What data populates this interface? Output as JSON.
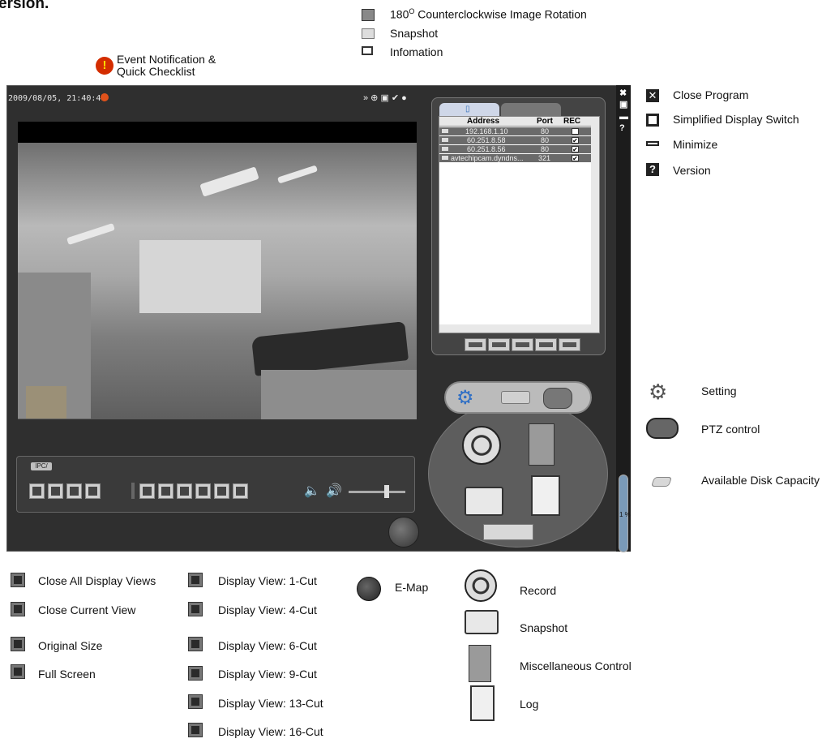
{
  "header": {
    "cut_title": "ersion."
  },
  "top_legend": [
    {
      "label": "180° Counterclockwise Image Rotation",
      "label_base": "180",
      "label_sup": "O",
      "label_rest": " Counterclockwise Image Rotation",
      "icon": "rotate-icon"
    },
    {
      "label": "Snapshot",
      "icon": "camera-small-icon"
    },
    {
      "label": "Infomation",
      "icon": "info-box-icon"
    }
  ],
  "event": {
    "line1": "Event Notification &",
    "line2": "Quick Checklist",
    "icon": "alert-icon"
  },
  "app": {
    "timestamp": "2009/08/05, 21:40:41",
    "osd_icons": "» ⊕ ▣ ✔ ●",
    "ipc_label": "IPC/",
    "address_list": {
      "headers": [
        "Address",
        "Port",
        "REC"
      ],
      "rows": [
        {
          "address": "192.168.1.10",
          "port": "80",
          "rec": ""
        },
        {
          "address": "60.251.8.58",
          "port": "80",
          "rec": "✔"
        },
        {
          "address": "60.251.8.56",
          "port": "80",
          "rec": "✔"
        },
        {
          "address": "avtechipcam.dyndns...",
          "port": "321",
          "rec": "✔"
        }
      ]
    },
    "disk_capacity": "1 %"
  },
  "right_legend": [
    {
      "label": "Close Program",
      "icon": "close-icon"
    },
    {
      "label": "Simplified Display Switch",
      "icon": "window-switch-icon"
    },
    {
      "label": "Minimize",
      "icon": "minimize-icon"
    },
    {
      "label": "Version",
      "icon": "question-icon"
    }
  ],
  "right_lower_legend": [
    {
      "label": "Setting",
      "icon": "gears-icon"
    },
    {
      "label": "PTZ control",
      "icon": "ptz-icon"
    },
    {
      "label": "Available Disk Capacity",
      "icon": "disk-icon"
    }
  ],
  "bottom_legend": {
    "col1": [
      "Close All Display Views",
      "Close Current View",
      "Original Size",
      "Full Screen"
    ],
    "col2": [
      "Display View: 1-Cut",
      "Display View: 4-Cut",
      "Display View: 6-Cut",
      "Display View: 9-Cut",
      "Display View: 13-Cut",
      "Display View: 16-Cut"
    ],
    "emap": "E-Map",
    "col4": [
      "Record",
      "Snapshot",
      "Miscellaneous Control",
      "Log"
    ]
  }
}
